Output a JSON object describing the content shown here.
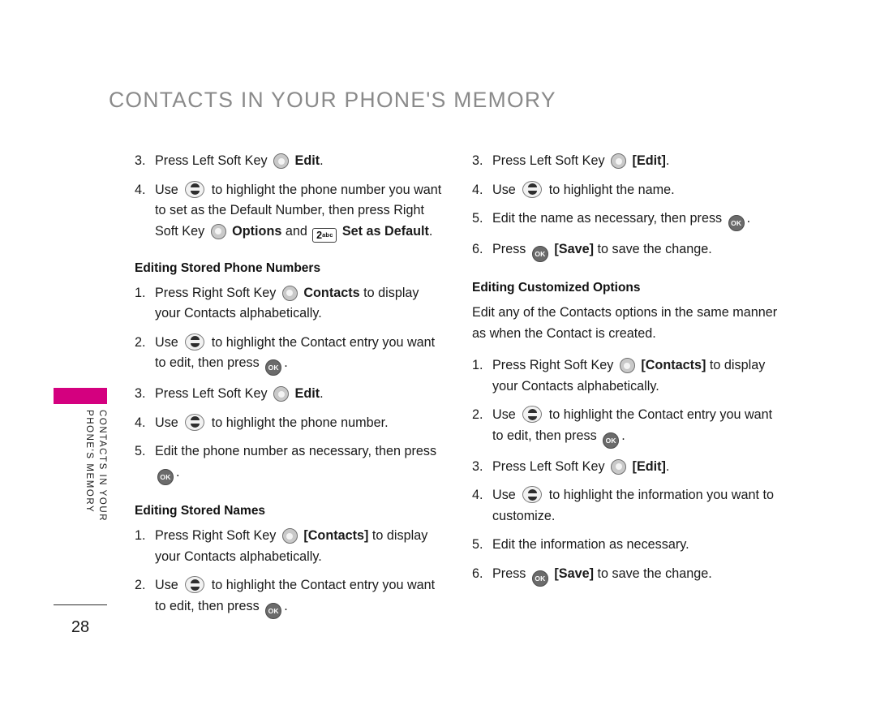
{
  "header": {
    "title": "CONTACTS IN YOUR PHONE'S MEMORY",
    "title_color": "#8a8a8a"
  },
  "side_rail": {
    "tab_color": "#d4007f",
    "running_head_line1": "CONTACTS IN YOUR",
    "running_head_line2": "PHONE'S MEMORY",
    "page_number": "28"
  },
  "icons": {
    "soft_key": "soft-key-icon",
    "ok_key": "ok-key-icon",
    "ok_key_label": "OK",
    "nav_key": "navigation-key-icon",
    "keypad_2": "keypad-2-abc-icon",
    "keypad_2_digit": "2",
    "keypad_2_letters": "abc"
  },
  "left_column": {
    "steps_top": [
      {
        "num": "3.",
        "parts": [
          {
            "t": "text",
            "v": "Press Left Soft Key "
          },
          {
            "t": "icon",
            "v": "soft"
          },
          {
            "t": "bold",
            "v": " Edit"
          },
          {
            "t": "text",
            "v": "."
          }
        ]
      },
      {
        "num": "4.",
        "parts": [
          {
            "t": "text",
            "v": "Use "
          },
          {
            "t": "icon",
            "v": "nav"
          },
          {
            "t": "text",
            "v": " to highlight the phone number you want to set as the Default Number, then press  Right Soft Key "
          },
          {
            "t": "icon",
            "v": "soft"
          },
          {
            "t": "bold",
            "v": " Options"
          },
          {
            "t": "text",
            "v": " and "
          },
          {
            "t": "icon",
            "v": "pad2"
          },
          {
            "t": "bold",
            "v": " Set as Default"
          },
          {
            "t": "text",
            "v": "."
          }
        ]
      }
    ],
    "heading_1": "Editing Stored Phone Numbers",
    "steps_phone_numbers": [
      {
        "num": "1.",
        "parts": [
          {
            "t": "text",
            "v": "Press Right Soft Key "
          },
          {
            "t": "icon",
            "v": "soft"
          },
          {
            "t": "bold",
            "v": " Contacts"
          },
          {
            "t": "text",
            "v": " to display your Contacts alphabetically."
          }
        ]
      },
      {
        "num": "2.",
        "parts": [
          {
            "t": "text",
            "v": "Use "
          },
          {
            "t": "icon",
            "v": "nav"
          },
          {
            "t": "text",
            "v": " to highlight the Contact entry you want to edit, then press "
          },
          {
            "t": "icon",
            "v": "ok"
          },
          {
            "t": "text",
            "v": "."
          }
        ]
      },
      {
        "num": "3.",
        "parts": [
          {
            "t": "text",
            "v": "Press Left Soft Key "
          },
          {
            "t": "icon",
            "v": "soft"
          },
          {
            "t": "bold",
            "v": " Edit"
          },
          {
            "t": "text",
            "v": "."
          }
        ]
      },
      {
        "num": "4.",
        "parts": [
          {
            "t": "text",
            "v": "Use "
          },
          {
            "t": "icon",
            "v": "nav"
          },
          {
            "t": "text",
            "v": " to highlight the phone number."
          }
        ]
      },
      {
        "num": "5.",
        "parts": [
          {
            "t": "text",
            "v": "Edit the phone number as necessary, then press "
          },
          {
            "t": "icon",
            "v": "ok"
          },
          {
            "t": "text",
            "v": "."
          }
        ]
      }
    ],
    "heading_2": "Editing Stored Names",
    "steps_names": [
      {
        "num": "1.",
        "parts": [
          {
            "t": "text",
            "v": "Press Right Soft Key "
          },
          {
            "t": "icon",
            "v": "soft"
          },
          {
            "t": "bold",
            "v": " [Contacts]"
          },
          {
            "t": "text",
            "v": " to display your Contacts alphabetically."
          }
        ]
      },
      {
        "num": "2.",
        "parts": [
          {
            "t": "text",
            "v": "Use "
          },
          {
            "t": "icon",
            "v": "nav"
          },
          {
            "t": "text",
            "v": " to highlight the Contact entry you want to edit, then press "
          },
          {
            "t": "icon",
            "v": "ok"
          },
          {
            "t": "text",
            "v": "."
          }
        ]
      }
    ]
  },
  "right_column": {
    "steps_top": [
      {
        "num": "3.",
        "parts": [
          {
            "t": "text",
            "v": "Press Left Soft Key "
          },
          {
            "t": "icon",
            "v": "soft"
          },
          {
            "t": "bold",
            "v": " [Edit]"
          },
          {
            "t": "text",
            "v": "."
          }
        ]
      },
      {
        "num": "4.",
        "parts": [
          {
            "t": "text",
            "v": "Use "
          },
          {
            "t": "icon",
            "v": "nav"
          },
          {
            "t": "text",
            "v": " to highlight the name."
          }
        ]
      },
      {
        "num": "5.",
        "parts": [
          {
            "t": "text",
            "v": "Edit the name as necessary, then press "
          },
          {
            "t": "icon",
            "v": "ok"
          },
          {
            "t": "text",
            "v": "."
          }
        ]
      },
      {
        "num": "6.",
        "parts": [
          {
            "t": "text",
            "v": "Press "
          },
          {
            "t": "icon",
            "v": "ok"
          },
          {
            "t": "bold",
            "v": " [Save]"
          },
          {
            "t": "text",
            "v": " to save the change."
          }
        ]
      }
    ],
    "heading_1": "Editing Customized Options",
    "intro": "Edit any of the Contacts options in the same manner as when the Contact is created.",
    "steps_options": [
      {
        "num": "1.",
        "parts": [
          {
            "t": "text",
            "v": "Press Right Soft Key "
          },
          {
            "t": "icon",
            "v": "soft"
          },
          {
            "t": "bold",
            "v": " [Contacts]"
          },
          {
            "t": "text",
            "v": " to display your Contacts alphabetically."
          }
        ]
      },
      {
        "num": "2.",
        "parts": [
          {
            "t": "text",
            "v": "Use "
          },
          {
            "t": "icon",
            "v": "nav"
          },
          {
            "t": "text",
            "v": " to highlight the Contact entry you want to edit, then press "
          },
          {
            "t": "icon",
            "v": "ok"
          },
          {
            "t": "text",
            "v": "."
          }
        ]
      },
      {
        "num": "3.",
        "parts": [
          {
            "t": "text",
            "v": "Press Left Soft Key "
          },
          {
            "t": "icon",
            "v": "soft"
          },
          {
            "t": "bold",
            "v": " [Edit]"
          },
          {
            "t": "text",
            "v": "."
          }
        ]
      },
      {
        "num": "4.",
        "parts": [
          {
            "t": "text",
            "v": "Use "
          },
          {
            "t": "icon",
            "v": "nav"
          },
          {
            "t": "text",
            "v": " to highlight the information you want to customize."
          }
        ]
      },
      {
        "num": "5.",
        "parts": [
          {
            "t": "text",
            "v": "Edit the information as necessary."
          }
        ]
      },
      {
        "num": "6.",
        "parts": [
          {
            "t": "text",
            "v": "Press "
          },
          {
            "t": "icon",
            "v": "ok"
          },
          {
            "t": "bold",
            "v": " [Save]"
          },
          {
            "t": "text",
            "v": " to save the change."
          }
        ]
      }
    ]
  }
}
